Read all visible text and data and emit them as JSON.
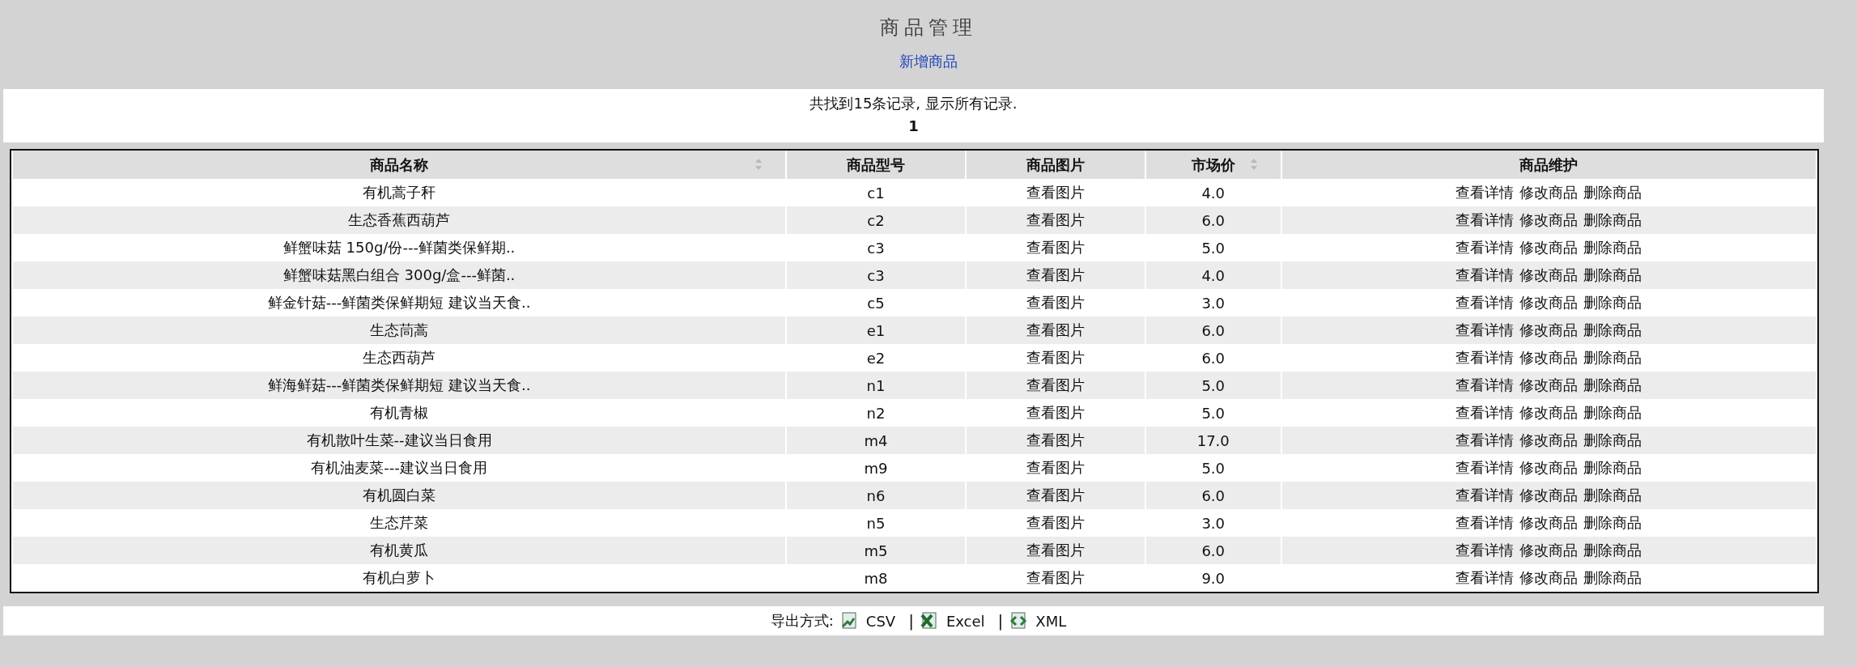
{
  "page": {
    "title": "商品管理",
    "add_link": "新增商品"
  },
  "summary": {
    "message": "共找到15条记录, 显示所有记录.",
    "pages": "1"
  },
  "table": {
    "columns": [
      {
        "label": "商品名称",
        "sortable": true
      },
      {
        "label": "商品型号",
        "sortable": false
      },
      {
        "label": "商品图片",
        "sortable": false
      },
      {
        "label": "市场价",
        "sortable": true
      },
      {
        "label": "商品维护",
        "sortable": false
      }
    ],
    "rows": [
      {
        "name": "有机蒿子秆",
        "model": "c1",
        "image_link": "查看图片",
        "price": "4.0",
        "actions": [
          "查看详情",
          "修改商品",
          "删除商品"
        ]
      },
      {
        "name": "生态香蕉西葫芦",
        "model": "c2",
        "image_link": "查看图片",
        "price": "6.0",
        "actions": [
          "查看详情",
          "修改商品",
          "删除商品"
        ]
      },
      {
        "name": "鲜蟹味菇 150g/份---鲜菌类保鲜期..",
        "model": "c3",
        "image_link": "查看图片",
        "price": "5.0",
        "actions": [
          "查看详情",
          "修改商品",
          "删除商品"
        ]
      },
      {
        "name": "鲜蟹味菇黑白组合 300g/盒---鲜菌..",
        "model": "c3",
        "image_link": "查看图片",
        "price": "4.0",
        "actions": [
          "查看详情",
          "修改商品",
          "删除商品"
        ]
      },
      {
        "name": "鲜金针菇---鲜菌类保鲜期短 建议当天食..",
        "model": "c5",
        "image_link": "查看图片",
        "price": "3.0",
        "actions": [
          "查看详情",
          "修改商品",
          "删除商品"
        ]
      },
      {
        "name": "生态茼蒿",
        "model": "e1",
        "image_link": "查看图片",
        "price": "6.0",
        "actions": [
          "查看详情",
          "修改商品",
          "删除商品"
        ]
      },
      {
        "name": "生态西葫芦",
        "model": "e2",
        "image_link": "查看图片",
        "price": "6.0",
        "actions": [
          "查看详情",
          "修改商品",
          "删除商品"
        ]
      },
      {
        "name": "鲜海鲜菇---鲜菌类保鲜期短 建议当天食..",
        "model": "n1",
        "image_link": "查看图片",
        "price": "5.0",
        "actions": [
          "查看详情",
          "修改商品",
          "删除商品"
        ]
      },
      {
        "name": "有机青椒",
        "model": "n2",
        "image_link": "查看图片",
        "price": "5.0",
        "actions": [
          "查看详情",
          "修改商品",
          "删除商品"
        ]
      },
      {
        "name": "有机散叶生菜--建议当日食用",
        "model": "m4",
        "image_link": "查看图片",
        "price": "17.0",
        "actions": [
          "查看详情",
          "修改商品",
          "删除商品"
        ]
      },
      {
        "name": "有机油麦菜---建议当日食用",
        "model": "m9",
        "image_link": "查看图片",
        "price": "5.0",
        "actions": [
          "查看详情",
          "修改商品",
          "删除商品"
        ]
      },
      {
        "name": "有机圆白菜",
        "model": "n6",
        "image_link": "查看图片",
        "price": "6.0",
        "actions": [
          "查看详情",
          "修改商品",
          "删除商品"
        ]
      },
      {
        "name": "生态芹菜",
        "model": "n5",
        "image_link": "查看图片",
        "price": "3.0",
        "actions": [
          "查看详情",
          "修改商品",
          "删除商品"
        ]
      },
      {
        "name": "有机黄瓜",
        "model": "m5",
        "image_link": "查看图片",
        "price": "6.0",
        "actions": [
          "查看详情",
          "修改商品",
          "删除商品"
        ]
      },
      {
        "name": "有机白萝卜",
        "model": "m8",
        "image_link": "查看图片",
        "price": "9.0",
        "actions": [
          "查看详情",
          "修改商品",
          "删除商品"
        ]
      }
    ]
  },
  "export": {
    "label": "导出方式:",
    "formats": [
      {
        "kind": "csv",
        "label": "CSV"
      },
      {
        "kind": "excel",
        "label": "Excel"
      },
      {
        "kind": "xml",
        "label": "XML"
      }
    ],
    "separator": "|"
  }
}
